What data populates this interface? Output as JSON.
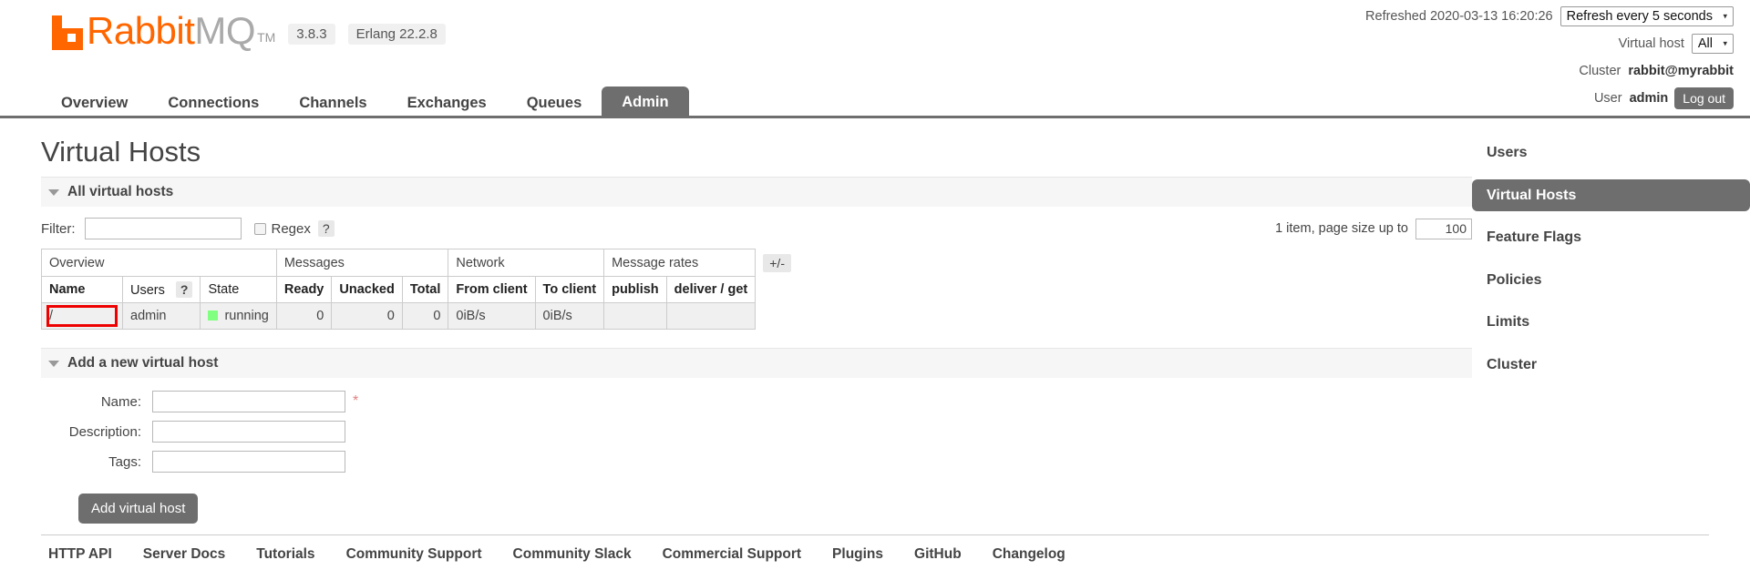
{
  "header": {
    "product_rabbit": "Rabbit",
    "product_mq": "MQ",
    "trademark": "TM",
    "version": "3.8.3",
    "erlang": "Erlang 22.2.8",
    "refreshed_label": "Refreshed 2020-03-13 16:20:26",
    "refresh_select_value": "Refresh every 5 seconds",
    "vhost_label": "Virtual host",
    "vhost_select_value": "All",
    "cluster_label": "Cluster",
    "cluster_name": "rabbit@myrabbit",
    "user_label": "User",
    "user_name": "admin",
    "logout_label": "Log out",
    "caret": "▾"
  },
  "nav": {
    "tabs": [
      {
        "label": "Overview",
        "active": false
      },
      {
        "label": "Connections",
        "active": false
      },
      {
        "label": "Channels",
        "active": false
      },
      {
        "label": "Exchanges",
        "active": false
      },
      {
        "label": "Queues",
        "active": false
      },
      {
        "label": "Admin",
        "active": true
      }
    ]
  },
  "main": {
    "page_title": "Virtual Hosts",
    "all_vhosts_section": "All virtual hosts",
    "filter": {
      "label": "Filter:",
      "value": "",
      "placeholder": "",
      "regex_label": "Regex",
      "regex_checked": false,
      "help": "?"
    },
    "paging": {
      "text": "1 item, page size up to",
      "page_size": "100"
    },
    "table": {
      "group_headers": [
        {
          "label": "Overview",
          "span": 3
        },
        {
          "label": "Messages",
          "span": 3
        },
        {
          "label": "Network",
          "span": 2
        },
        {
          "label": "Message rates",
          "span": 2
        }
      ],
      "plus_minus": "+/-",
      "columns": [
        "Name",
        "Users",
        "State",
        "Ready",
        "Unacked",
        "Total",
        "From client",
        "To client",
        "publish",
        "deliver / get"
      ],
      "users_help": "?",
      "rows": [
        {
          "name": "/",
          "name_highlighted": true,
          "users": "admin",
          "state": "running",
          "state_color": "#80ff80",
          "ready": "0",
          "unacked": "0",
          "total": "0",
          "from_client": "0iB/s",
          "to_client": "0iB/s",
          "publish": "",
          "deliver_get": ""
        }
      ]
    },
    "add_section": {
      "title": "Add a new virtual host",
      "fields": [
        {
          "label": "Name:",
          "value": "",
          "required": true
        },
        {
          "label": "Description:",
          "value": "",
          "required": false
        },
        {
          "label": "Tags:",
          "value": "",
          "required": false
        }
      ],
      "required_mark": "*",
      "submit_label": "Add virtual host"
    }
  },
  "sidebar": {
    "items": [
      {
        "label": "Users",
        "active": false
      },
      {
        "label": "Virtual Hosts",
        "active": true
      },
      {
        "label": "Feature Flags",
        "active": false
      },
      {
        "label": "Policies",
        "active": false
      },
      {
        "label": "Limits",
        "active": false
      },
      {
        "label": "Cluster",
        "active": false
      }
    ]
  },
  "footer": {
    "links": [
      "HTTP API",
      "Server Docs",
      "Tutorials",
      "Community Support",
      "Community Slack",
      "Commercial Support",
      "Plugins",
      "GitHub",
      "Changelog"
    ]
  }
}
